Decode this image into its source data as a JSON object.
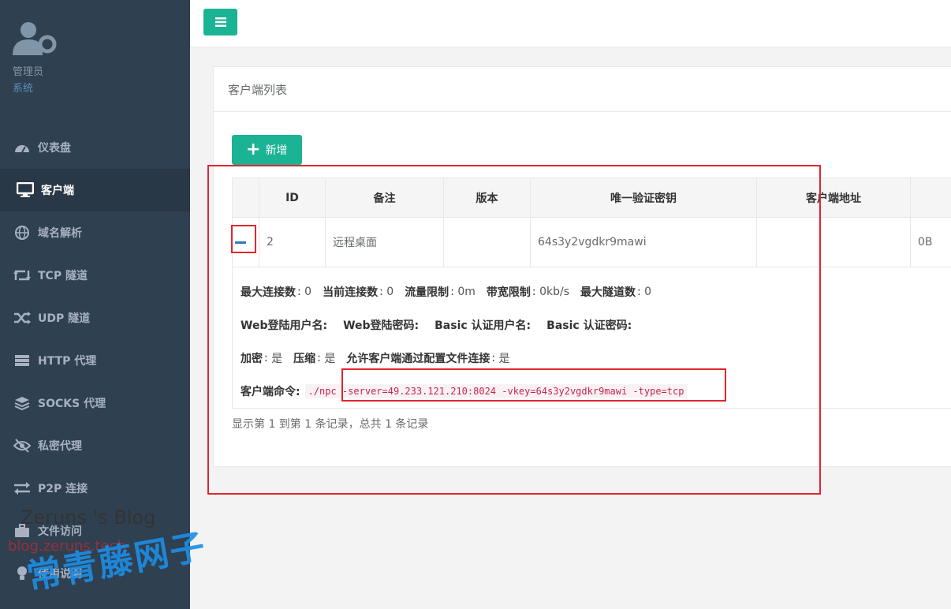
{
  "profile": {
    "name": "管理员",
    "role": "系统"
  },
  "sidebar": {
    "items": [
      {
        "label": "仪表盘",
        "icon": "dashboard-icon"
      },
      {
        "label": "客户端",
        "icon": "desktop-icon"
      },
      {
        "label": "域名解析",
        "icon": "globe-icon"
      },
      {
        "label": "TCP 隧道",
        "icon": "retweet-icon"
      },
      {
        "label": "UDP 隧道",
        "icon": "random-icon"
      },
      {
        "label": "HTTP 代理",
        "icon": "server-icon"
      },
      {
        "label": "SOCKS 代理",
        "icon": "layers-icon"
      },
      {
        "label": "私密代理",
        "icon": "eye-slash-icon"
      },
      {
        "label": "P2P 连接",
        "icon": "exchange-icon"
      },
      {
        "label": "文件访问",
        "icon": "briefcase-icon"
      },
      {
        "label": "使用说明",
        "icon": "lightbulb-icon"
      }
    ]
  },
  "panel": {
    "title": "客户端列表",
    "add_label": "新增"
  },
  "table": {
    "headers": [
      "",
      "ID",
      "备注",
      "版本",
      "唯一验证密钥",
      "客户端地址",
      ""
    ],
    "row": {
      "id": "2",
      "remark": "远程桌面",
      "version": "",
      "vkey": "64s3y2vgdkr9mawi",
      "addr": "",
      "traffic": "0B"
    }
  },
  "detail": {
    "max_conn_label": "最大连接数",
    "max_conn": "0",
    "cur_conn_label": "当前连接数",
    "cur_conn": "0",
    "flow_label": "流量限制",
    "flow": "0m",
    "rate_label": "带宽限制",
    "rate": "0kb/s",
    "max_tunnel_label": "最大隧道数",
    "max_tunnel": "0",
    "web_user_label": "Web登陆用户名:",
    "web_pass_label": "Web登陆密码:",
    "basic_user_label": "Basic 认证用户名:",
    "basic_pass_label": "Basic 认证密码:",
    "crypt_label": "加密",
    "crypt": "是",
    "compress_label": "压缩",
    "compress": "是",
    "config_conn_label": "允许客户端通过配置文件连接",
    "config_conn": "是",
    "cmd_label": "客户端命令:",
    "cmd_prefix": "./npc",
    "cmd_args": " -server=49.233.121.210:8024 -vkey=64s3y2vgdkr9mawi -type=tcp"
  },
  "pagination": {
    "info": "显示第 1 到第 1 条记录，总共 1 条记录"
  },
  "watermark": {
    "blog": "Zeruns 's Blog",
    "url": "blog.zeruns.tech",
    "cn": "常青藤网子"
  },
  "colors": {
    "sidebar": "#2f4050",
    "accent": "#1ab394",
    "highlight": "#e0262e"
  }
}
